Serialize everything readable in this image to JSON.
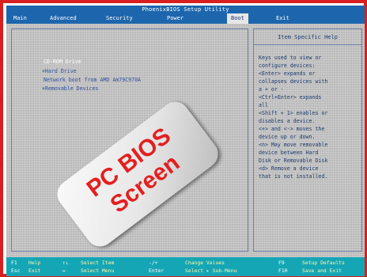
{
  "title": "PhoenixBIOS Setup Utility",
  "menu": {
    "items": [
      {
        "label": "Main"
      },
      {
        "label": "Advanced"
      },
      {
        "label": "Security"
      },
      {
        "label": "Power"
      },
      {
        "label": "Boot"
      },
      {
        "label": "Exit"
      }
    ],
    "active": "Boot"
  },
  "boot": {
    "items": [
      {
        "label": "CD-ROM Drive"
      },
      {
        "label": "+Hard Drive"
      },
      {
        "label": "Network boot from AMD Am79C970A"
      },
      {
        "label": "+Removable Devices"
      }
    ]
  },
  "help": {
    "header": "Item Specific Help",
    "lines": [
      "Keys used to view or",
      "configure devices:",
      "<Enter> expands or",
      "collapses devices with",
      "a + or -",
      "<Ctrl+Enter> expands",
      "all",
      "<Shift + 1> enables or",
      "disables a device.",
      "<+> and <-> moves the",
      "device up or down.",
      "<n> May move removable",
      "device between Hard",
      "Disk or Removable Disk",
      "<d> Remove a device",
      "that is not installed."
    ]
  },
  "overlay": {
    "line1": "PC BIOS",
    "line2": "Screen",
    "text_color": "#e31f1f"
  },
  "status": {
    "row1": [
      {
        "key": "F1",
        "desc": "Help"
      },
      {
        "key": "↑↓",
        "desc": "Select Item"
      },
      {
        "key": "-/+",
        "desc": "Change Values"
      },
      {
        "key": "F9",
        "desc": "Setup Defaults"
      }
    ],
    "row2": [
      {
        "key": "Esc",
        "desc": "Exit"
      },
      {
        "key": "↔",
        "desc": "Select Menu"
      },
      {
        "key": "Enter",
        "desc": "Select ▸ Sub-Menu"
      },
      {
        "key": "F10",
        "desc": "Save and Exit"
      }
    ]
  },
  "colors": {
    "frame": "#d71f1f",
    "title_bar": "#1d66ad",
    "status_bar": "#15a6b5",
    "panel_text": "#1d3b6e"
  }
}
